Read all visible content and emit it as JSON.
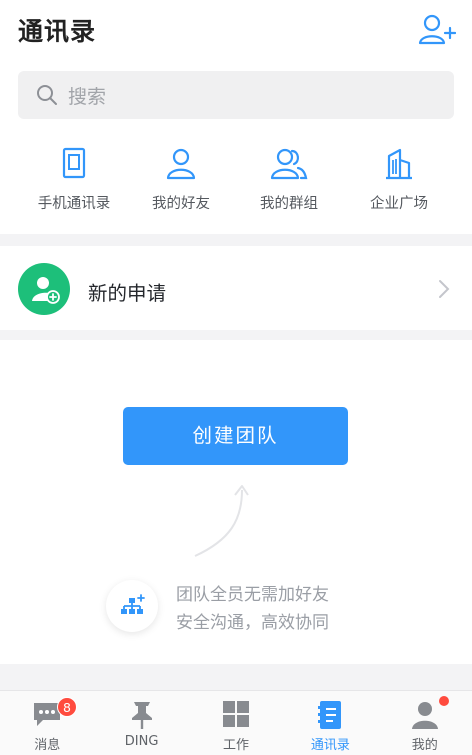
{
  "header": {
    "title": "通讯录",
    "add_icon": "add-contact-icon"
  },
  "search": {
    "placeholder": "搜索",
    "icon": "search-icon"
  },
  "quick_actions": [
    {
      "label": "手机通讯录",
      "icon": "phone-icon"
    },
    {
      "label": "我的好友",
      "icon": "person-icon"
    },
    {
      "label": "我的群组",
      "icon": "group-icon"
    },
    {
      "label": "企业广场",
      "icon": "building-icon"
    }
  ],
  "new_request": {
    "label": "新的申请",
    "icon": "add-user-icon"
  },
  "team": {
    "create_label": "创建团队",
    "tip_line1": "团队全员无需加好友",
    "tip_line2": "安全沟通，高效协同"
  },
  "tabbar": {
    "tabs": [
      {
        "label": "消息",
        "badge": "8",
        "icon": "message-icon"
      },
      {
        "label": "DING",
        "icon": "pin-icon"
      },
      {
        "label": "工作",
        "icon": "grid-icon"
      },
      {
        "label": "通讯录",
        "icon": "contacts-book-icon",
        "active": true
      },
      {
        "label": "我的",
        "icon": "profile-icon",
        "dot": true
      }
    ]
  },
  "colors": {
    "accent": "#3296fa",
    "green": "#1dbf7a",
    "badge": "#ff4b3e"
  }
}
